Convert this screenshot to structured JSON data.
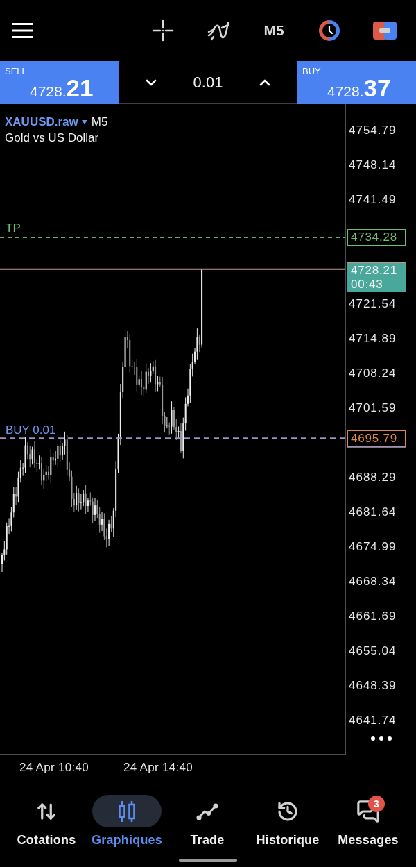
{
  "toolbar": {
    "timeframe": "M5"
  },
  "trade_bar": {
    "sell": {
      "label": "SELL",
      "price_prefix": "4728.",
      "price_pips": "21"
    },
    "volume": "0.01",
    "buy": {
      "label": "BUY",
      "price_prefix": "4728.",
      "price_pips": "37"
    }
  },
  "chart": {
    "symbol": "XAUUSD.raw",
    "timeframe": "M5",
    "description": "Gold vs US Dollar",
    "price_axis": [
      "4754.79",
      "4748.14",
      "4741.49",
      "4721.54",
      "4714.89",
      "4708.24",
      "4701.59",
      "4688.29",
      "4681.64",
      "4674.99",
      "4668.34",
      "4661.69",
      "4655.04",
      "4648.39",
      "4641.74"
    ],
    "take_profit": {
      "label": "TP",
      "price": "4734.28"
    },
    "current_price": {
      "price": "4728.21",
      "countdown": "00:43"
    },
    "order": {
      "label": "BUY 0.01",
      "price": "4695.79"
    },
    "time_axis": [
      "24 Apr 10:40",
      "24 Apr 14:40"
    ]
  },
  "bottom_nav": [
    {
      "label": "Cotations",
      "selected": false
    },
    {
      "label": "Graphiques",
      "selected": true
    },
    {
      "label": "Trade",
      "selected": false
    },
    {
      "label": "Historique",
      "selected": false
    },
    {
      "label": "Messages",
      "selected": false,
      "badge": "3"
    }
  ]
}
